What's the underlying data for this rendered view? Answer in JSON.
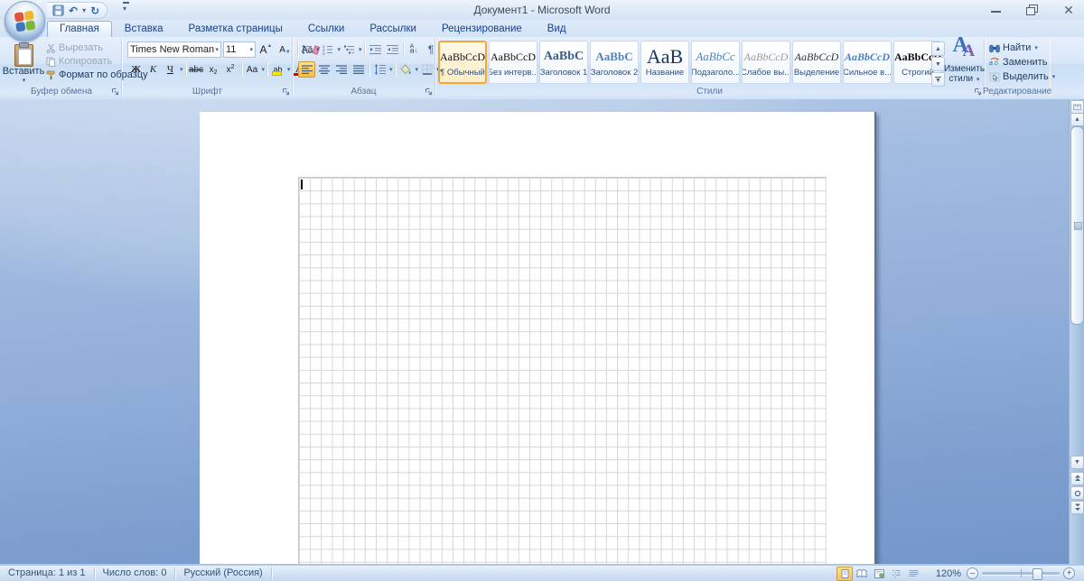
{
  "window": {
    "title": "Документ1 - Microsoft Word",
    "controls": [
      "minimize",
      "restore",
      "close"
    ]
  },
  "quick_access": {
    "icons": [
      "save-icon",
      "undo-icon",
      "redo-icon",
      "customize-qat-arrow"
    ]
  },
  "tabs": {
    "active": "Главная",
    "items": [
      "Главная",
      "Вставка",
      "Разметка страницы",
      "Ссылки",
      "Рассылки",
      "Рецензирование",
      "Вид"
    ]
  },
  "ribbon": {
    "clipboard": {
      "label": "Буфер обмена",
      "paste": "Вставить",
      "cut": "Вырезать",
      "copy": "Копировать",
      "format_painter": "Формат по образцу"
    },
    "font": {
      "label": "Шрифт",
      "font_name": "Times New Roman (О",
      "font_size": "11",
      "bold": "Ж",
      "italic": "К",
      "underline": "Ч",
      "strikethrough": "abc",
      "subscript": "х",
      "superscript": "х",
      "change_case": "Аа",
      "highlight": "ab",
      "font_color": "А"
    },
    "paragraph": {
      "label": "Абзац",
      "sort_letters": "АЯ",
      "pilcrow": "¶"
    },
    "styles": {
      "label": "Стили",
      "items": [
        {
          "preview": "AaBbCcD",
          "label": "¶ Обычный",
          "selected": true
        },
        {
          "preview": "AaBbCcD",
          "label": "Без интерв..."
        },
        {
          "preview": "AaBbC",
          "label": "Заголовок 1"
        },
        {
          "preview": "AaBbC",
          "label": "Заголовок 2"
        },
        {
          "preview": "AaB",
          "label": "Название"
        },
        {
          "preview": "AaBbCc",
          "label": "Подзаголо..."
        },
        {
          "preview": "AaBbCcD",
          "label": "Слабое вы..."
        },
        {
          "preview": "AaBbCcD",
          "label": "Выделение"
        },
        {
          "preview": "AaBbCcD",
          "label": "Сильное в..."
        },
        {
          "preview": "AaBbCcD",
          "label": "Строгий"
        }
      ],
      "change_styles_line1": "Изменить",
      "change_styles_line2": "стили"
    },
    "editing": {
      "label": "Редактирование",
      "find": "Найти",
      "replace": "Заменить",
      "select": "Выделить"
    }
  },
  "document": {
    "grid_columns": 48,
    "grid_rows_visible": 30,
    "cursor": "text-caret-in-first-cell"
  },
  "status_bar": {
    "page": "Страница: 1 из 1",
    "words": "Число слов: 0",
    "language": "Русский (Россия)",
    "zoom": "120%",
    "view_icons": [
      "print-layout-icon",
      "fullscreen-reading-icon",
      "web-layout-icon",
      "outline-icon",
      "draft-icon"
    ]
  },
  "colors": {
    "selection_orange": "#FBBF45",
    "highlight_yellow": "#FFE800",
    "font_color_red": "#E00000",
    "theme_blue": "#15428B",
    "heading_blue": "#4F81BD"
  }
}
